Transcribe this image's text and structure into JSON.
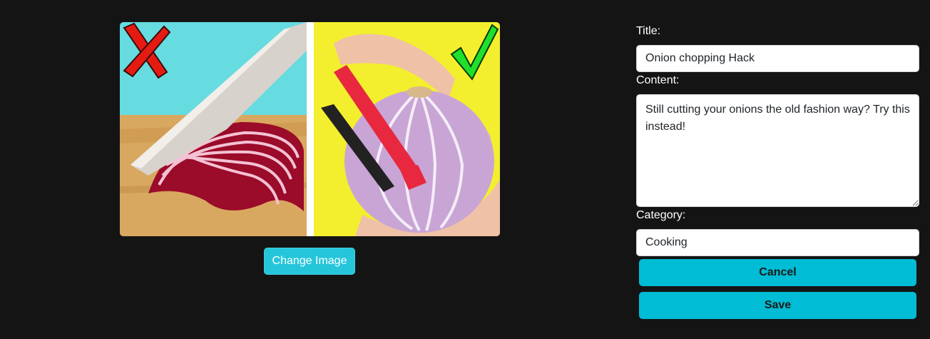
{
  "image": {
    "alt": "",
    "change_button_label": "Change Image",
    "left_mark_icon": "cross-icon",
    "right_mark_icon": "check-icon"
  },
  "form": {
    "title_label": "Title:",
    "title_value": "Onion chopping Hack",
    "content_label": "Content:",
    "content_value": "Still cutting your onions the old fashion way? Try this instead!",
    "category_label": "Category:",
    "category_value": "Cooking",
    "cancel_label": "Cancel",
    "save_label": "Save"
  },
  "colors": {
    "background": "#141414",
    "button_accent": "#00bcd4",
    "change_image_button": "#26c6da"
  }
}
